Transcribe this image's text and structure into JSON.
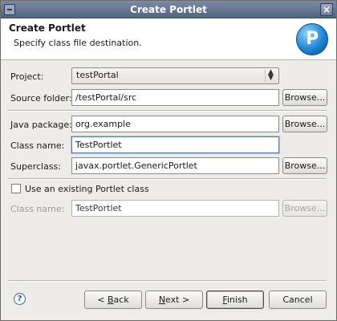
{
  "window": {
    "title": "Create Portlet"
  },
  "banner": {
    "title": "Create Portlet",
    "description": "Specify class file destination.",
    "logo_letter": "P",
    "logo_icon": "portlet-wizard-icon"
  },
  "form": {
    "project": {
      "label": "Project:",
      "value": "testPortal"
    },
    "source_folder": {
      "label": "Source folder:",
      "value": "/testPortal/src",
      "browse": "Browse..."
    },
    "java_package": {
      "label": "Java package:",
      "value": "org.example",
      "browse": "Browse..."
    },
    "class_name": {
      "label": "Class name:",
      "value": "TestPortlet"
    },
    "superclass": {
      "label": "Superclass:",
      "value": "javax.portlet.GenericPortlet",
      "browse": "Browse..."
    },
    "use_existing": {
      "label": "Use an existing Portlet class",
      "checked": false
    },
    "existing_class": {
      "label": "Class name:",
      "value": "TestPortlet",
      "browse": "Browse..."
    }
  },
  "buttons": {
    "back_prefix": "< ",
    "back_mnemonic": "B",
    "back_rest": "ack",
    "next_mnemonic": "N",
    "next_rest": "ext >",
    "finish_mnemonic": "F",
    "finish_rest": "inish",
    "cancel": "Cancel"
  },
  "colors": {
    "title_bar": "#53647f",
    "focus": "#5a7fae"
  }
}
